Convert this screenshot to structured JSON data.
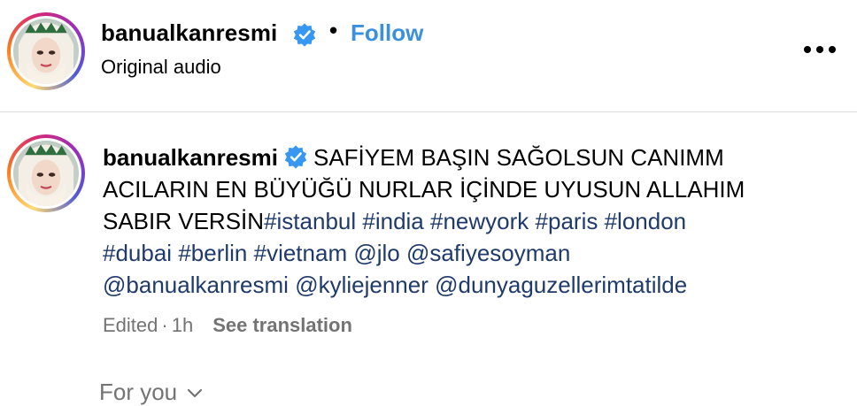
{
  "header": {
    "username": "banualkanresmi",
    "separator": "•",
    "follow_label": "Follow",
    "audio_label": "Original audio",
    "more_label": "•••"
  },
  "comment": {
    "username": "banualkanresmi",
    "text_line1": "SAFİYEM BAŞIN SAĞOLSUN CANIMM",
    "text_line2": "ACILARIN EN BÜYÜĞÜ NURLAR İÇİNDE UYUSUN ALLAHIM",
    "text_line3": "SABIR VERSİN",
    "hashtags": [
      "#istanbul",
      "#india",
      "#newyork",
      "#paris",
      "#london",
      "#dubai",
      "#berlin",
      "#vietnam"
    ],
    "mentions": [
      "@jlo",
      "@safiyesoyman",
      "@banualkanresmi",
      "@kyliejenner",
      "@dunyaguzellerimtatilde"
    ],
    "edited_label": "Edited",
    "separator": "·",
    "time_ago": "1h",
    "see_translation_label": "See translation"
  },
  "footer": {
    "for_you_label": "For you"
  },
  "colors": {
    "link_blue": "#3a8fde",
    "tag_blue": "#1f3a6b",
    "muted_gray": "#737373",
    "verified_blue": "#3897f0",
    "divider": "#dbdbdb"
  },
  "icons": {
    "verified": "verified-badge-icon",
    "more": "more-options-icon",
    "chevron": "chevron-down-icon"
  }
}
